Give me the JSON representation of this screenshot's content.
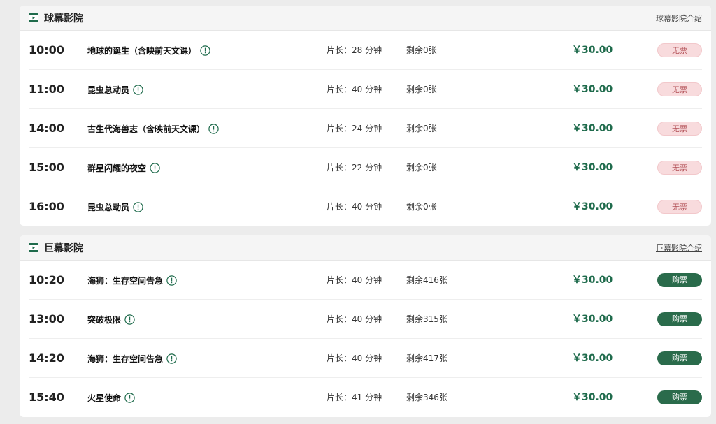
{
  "colors": {
    "accent_green": "#1f6b4c",
    "buy_button": "#2a6b4b",
    "soldout_bg": "#f8dbdd",
    "soldout_text": "#b4545a"
  },
  "halls": [
    {
      "name": "球幕影院",
      "intro_link": "球幕影院介绍",
      "icon": "screen-icon",
      "sessions": [
        {
          "time": "10:00",
          "title": "地球的诞生（含映前天文课）",
          "duration": "片长：28 分钟",
          "remaining": "剩余0张",
          "price": "￥30.00",
          "button": "无票",
          "status": "soldout"
        },
        {
          "time": "11:00",
          "title": "昆虫总动员",
          "duration": "片长：40 分钟",
          "remaining": "剩余0张",
          "price": "￥30.00",
          "button": "无票",
          "status": "soldout"
        },
        {
          "time": "14:00",
          "title": "古生代海兽志（含映前天文课）",
          "duration": "片长：24 分钟",
          "remaining": "剩余0张",
          "price": "￥30.00",
          "button": "无票",
          "status": "soldout"
        },
        {
          "time": "15:00",
          "title": "群星闪耀的夜空",
          "duration": "片长：22 分钟",
          "remaining": "剩余0张",
          "price": "￥30.00",
          "button": "无票",
          "status": "soldout"
        },
        {
          "time": "16:00",
          "title": "昆虫总动员",
          "duration": "片长：40 分钟",
          "remaining": "剩余0张",
          "price": "￥30.00",
          "button": "无票",
          "status": "soldout"
        }
      ]
    },
    {
      "name": "巨幕影院",
      "intro_link": "巨幕影院介绍",
      "icon": "screen-icon",
      "sessions": [
        {
          "time": "10:20",
          "title": "海狮：生存空间告急",
          "duration": "片长：40 分钟",
          "remaining": "剩余416张",
          "price": "￥30.00",
          "button": "购票",
          "status": "buy"
        },
        {
          "time": "13:00",
          "title": "突破极限",
          "duration": "片长：40 分钟",
          "remaining": "剩余315张",
          "price": "￥30.00",
          "button": "购票",
          "status": "buy"
        },
        {
          "time": "14:20",
          "title": "海狮：生存空间告急",
          "duration": "片长：40 分钟",
          "remaining": "剩余417张",
          "price": "￥30.00",
          "button": "购票",
          "status": "buy"
        },
        {
          "time": "15:40",
          "title": "火星使命",
          "duration": "片长：41 分钟",
          "remaining": "剩余346张",
          "price": "￥30.00",
          "button": "购票",
          "status": "buy"
        }
      ]
    }
  ]
}
